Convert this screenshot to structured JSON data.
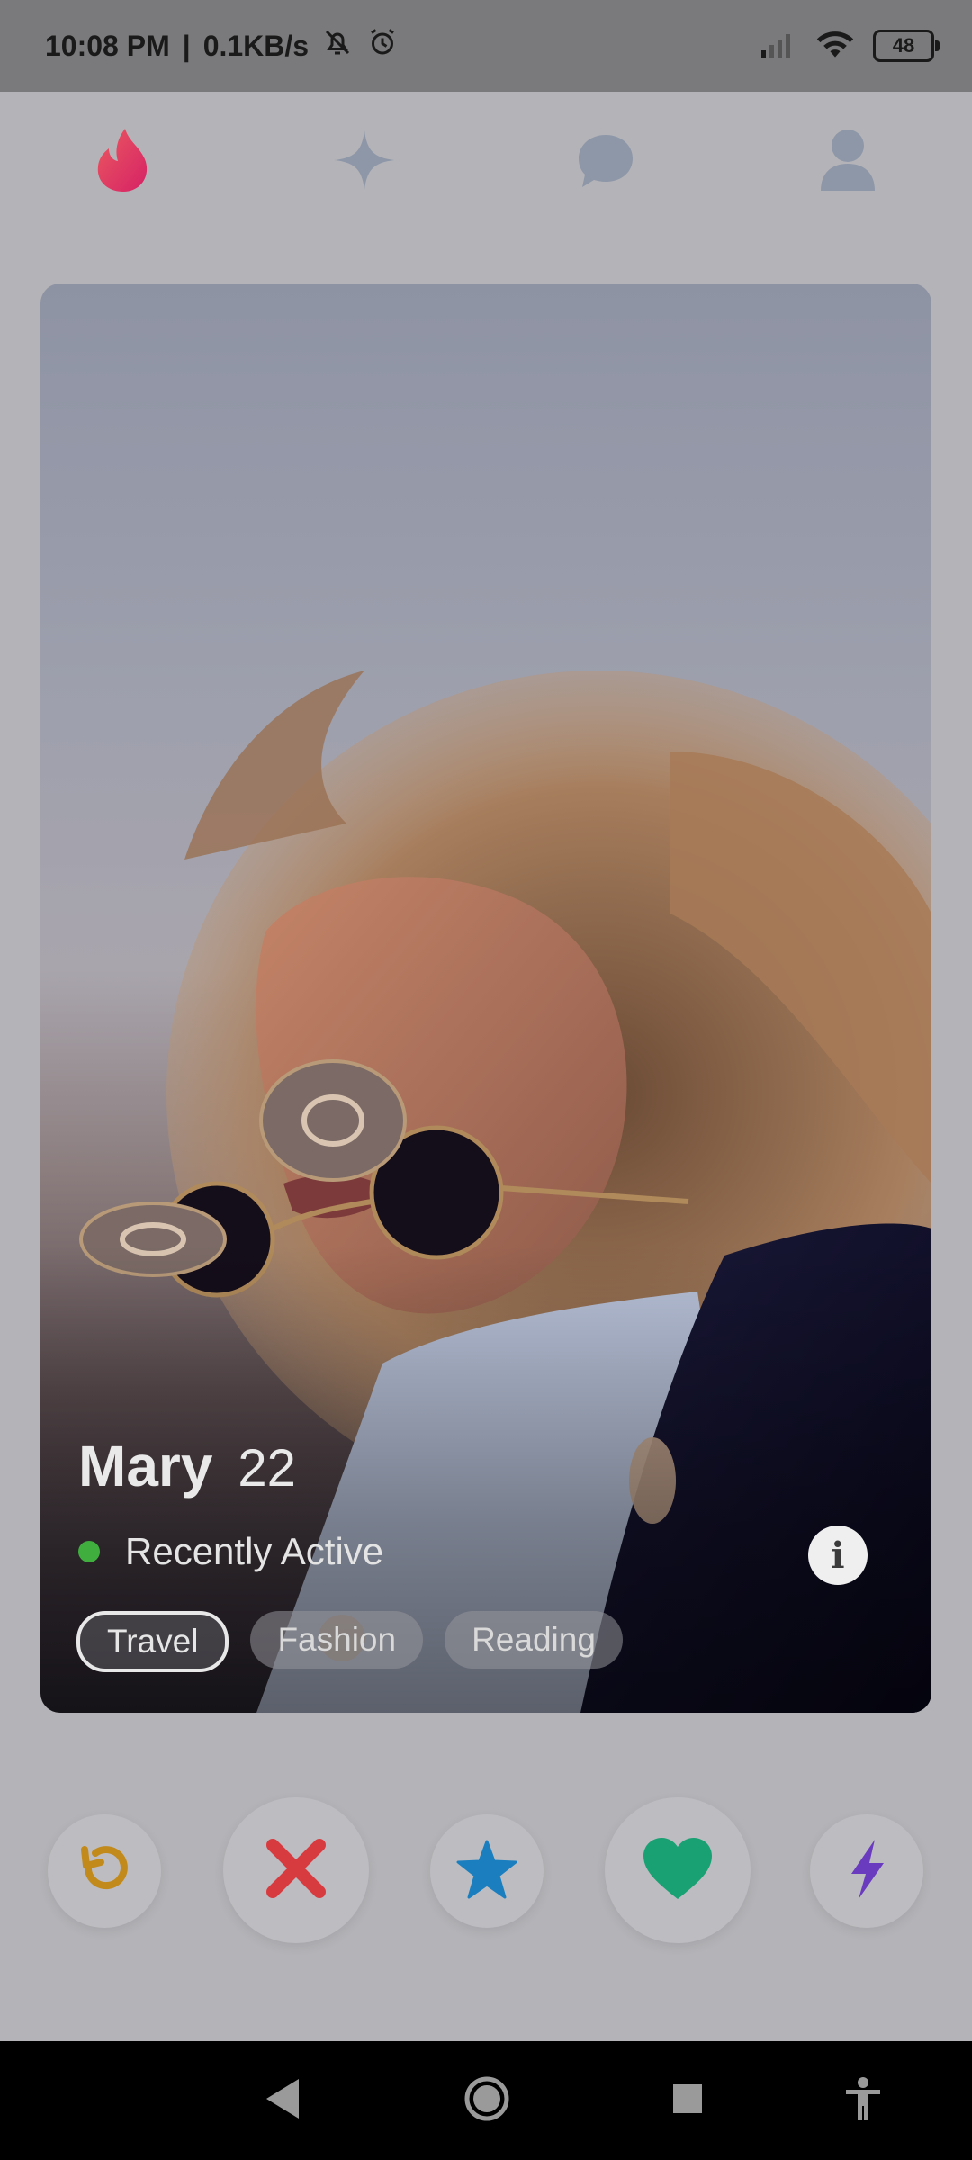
{
  "status_bar": {
    "time": "10:08 PM",
    "separator": "|",
    "network_speed": "0.1KB/s",
    "battery_level": "48",
    "icons": [
      "bell-muted-icon",
      "alarm-icon",
      "signal-icon",
      "wifi-icon",
      "battery-icon"
    ]
  },
  "top_nav": {
    "items": [
      {
        "name": "flame-icon",
        "active": true
      },
      {
        "name": "sparkle-icon",
        "active": false
      },
      {
        "name": "chat-bubble-icon",
        "active": false
      },
      {
        "name": "profile-icon",
        "active": false
      }
    ]
  },
  "profile": {
    "name": "Mary",
    "age": "22",
    "status": "Recently Active",
    "status_color": "#3fae3f",
    "interests": [
      "Travel",
      "Fashion",
      "Reading"
    ],
    "selected_interest": "Travel",
    "info_symbol": "i"
  },
  "actions": [
    {
      "name": "rewind-icon",
      "color": "#c28a1b"
    },
    {
      "name": "nope-icon",
      "color": "#d83b3f"
    },
    {
      "name": "super-like-icon",
      "color": "#1b7fbf"
    },
    {
      "name": "like-icon",
      "color": "#1aa173"
    },
    {
      "name": "boost-icon",
      "color": "#6a3bbf"
    }
  ],
  "system_nav": [
    "back-icon",
    "home-icon",
    "recents-icon",
    "accessibility-icon"
  ],
  "colors": {
    "flame_gradient_start": "#e04a6c",
    "flame_gradient_end": "#d8244f",
    "inactive_nav": "#8e97a8",
    "overlay_background": "#b4b4b8"
  }
}
